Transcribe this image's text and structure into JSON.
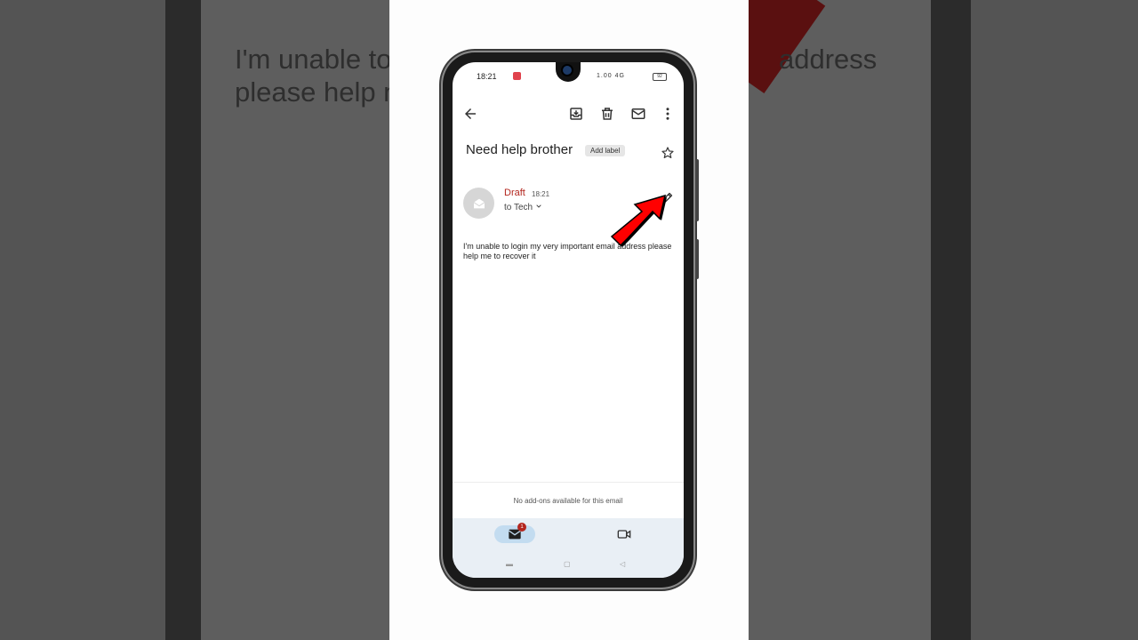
{
  "background": {
    "text_left": "I'm unable to\nplease help m",
    "text_right": "address"
  },
  "statusbar": {
    "time": "18:21",
    "icons": "1.00 4G",
    "battery": "92"
  },
  "appbar": {
    "back_icon": "arrow-left-icon",
    "archive_icon": "archive-icon",
    "delete_icon": "trash-icon",
    "mark_unread_icon": "mail-icon",
    "more_icon": "more-vertical-icon"
  },
  "email": {
    "subject": "Need help brother",
    "label_chip": "Add label",
    "sender": "Draft",
    "time": "18:21",
    "recipients": "to Tech",
    "body": "I'm unable to login my very important email address please help me to recover it"
  },
  "footer": {
    "addons_text": "No add-ons available for this email"
  },
  "bottomnav": {
    "mail_badge": "1"
  },
  "colors": {
    "draft": "#b3261e",
    "annotation_arrow": "#ff0000",
    "nav_pill": "#c3dcf0"
  }
}
